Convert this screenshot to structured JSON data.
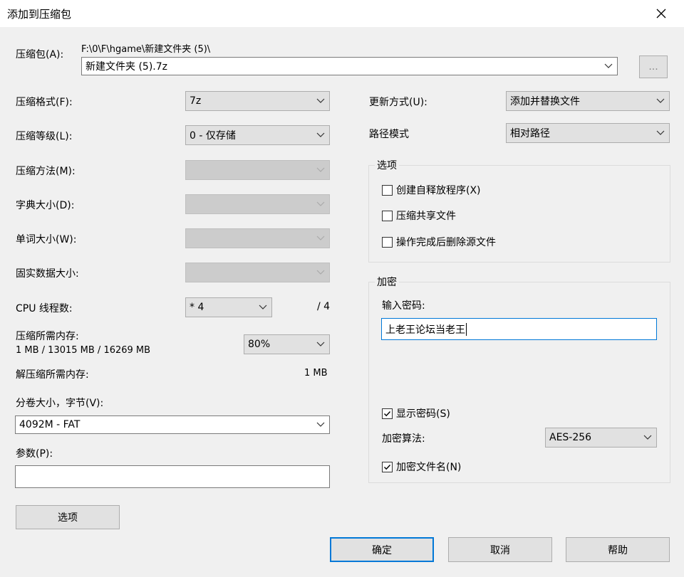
{
  "window": {
    "title": "添加到压缩包",
    "close_glyph": "✕"
  },
  "archive": {
    "label": "压缩包(A):",
    "path": "F:\\0\\F\\hgame\\新建文件夹 (5)\\",
    "name": "新建文件夹 (5).7z",
    "browse_label": "..."
  },
  "left": {
    "format": {
      "label": "压缩格式(F):",
      "value": "7z"
    },
    "level": {
      "label": "压缩等级(L):",
      "value": "0 - 仅存储"
    },
    "method": {
      "label": "压缩方法(M):",
      "value": ""
    },
    "dict": {
      "label": "字典大小(D):",
      "value": ""
    },
    "word": {
      "label": "单词大小(W):",
      "value": ""
    },
    "solid": {
      "label": "固实数据大小:",
      "value": ""
    },
    "threads": {
      "label": "CPU 线程数:",
      "value": "* 4",
      "max": "/ 4"
    },
    "memory": {
      "label": "压缩所需内存:",
      "detail": "1 MB / 13015 MB / 16269 MB",
      "percent": "80%"
    },
    "decomp": {
      "label": "解压缩所需内存:",
      "value": "1 MB"
    },
    "volume": {
      "label": "分卷大小，字节(V):",
      "value": "4092M - FAT"
    },
    "params": {
      "label": "参数(P):",
      "value": ""
    },
    "options_button": "选项"
  },
  "right": {
    "update": {
      "label": "更新方式(U):",
      "value": "添加并替换文件"
    },
    "path_mode": {
      "label": "路径模式",
      "value": "相对路径"
    },
    "options_group": {
      "title": "选项",
      "items": [
        {
          "label": "创建自释放程序(X)",
          "checked": false
        },
        {
          "label": "压缩共享文件",
          "checked": false
        },
        {
          "label": "操作完成后删除源文件",
          "checked": false
        }
      ]
    },
    "encryption": {
      "title": "加密",
      "password_label": "输入密码:",
      "password_value": "上老王论坛当老王",
      "show_password": {
        "label": "显示密码(S)",
        "checked": true
      },
      "method_label": "加密算法:",
      "method_value": "AES-256",
      "encrypt_names": {
        "label": "加密文件名(N)",
        "checked": true
      }
    }
  },
  "buttons": {
    "ok": "确定",
    "cancel": "取消",
    "help": "帮助"
  }
}
